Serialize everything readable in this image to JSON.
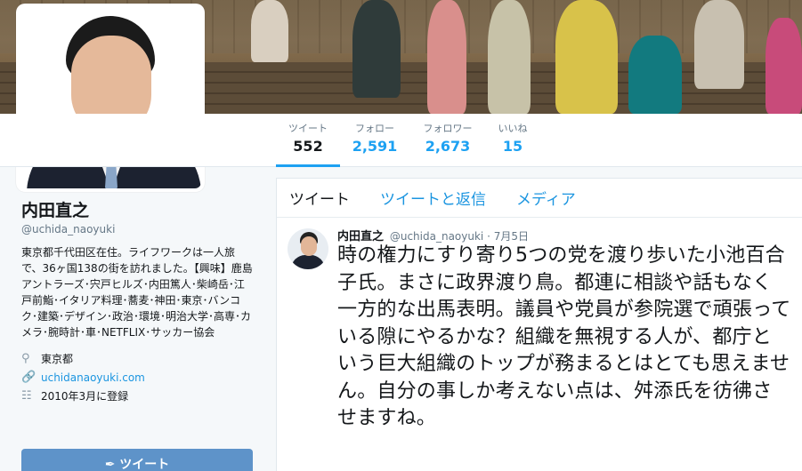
{
  "profile": {
    "name": "内田直之",
    "handle": "@uchida_naoyuki",
    "bio": "東京都千代田区在住。ライフワークは一人旅で、36ヶ国138の街を訪れました。【興味】鹿島アントラーズ･宍戸ヒルズ･内田篤人･柴崎岳･江戸前鮨･イタリア料理･蕎麦･神田･東京･バンコク･建築･デザイン･政治･環境･明治大学･高専･カメラ･腕時計･車･NETFLIX･サッカー協会",
    "location": "東京都",
    "url": "uchidanaoyuki.com",
    "joined": "2010年3月に登録",
    "tweet_button": "ツイート"
  },
  "stats": [
    {
      "label": "ツイート",
      "value": "552"
    },
    {
      "label": "フォロー",
      "value": "2,591"
    },
    {
      "label": "フォロワー",
      "value": "2,673"
    },
    {
      "label": "いいね",
      "value": "15"
    }
  ],
  "tabs": [
    "ツイート",
    "ツイートと返信",
    "メディア"
  ],
  "tweet": {
    "name": "内田直之",
    "handle": "@uchida_naoyuki",
    "date": "· 7月5日",
    "text": "時の権力にすり寄り5つの党を渡り歩いた小池百合子氏。まさに政界渡り鳥。都連に相談や話もなく一方的な出馬表明。議員や党員が参院選で頑張っている隙にやるかな？組織を無視する人が、都庁という巨大組織のトップが務まるとはとても思えません。自分の事しか考えない点は、舛添氏を彷彿させますね。"
  },
  "colors": {
    "accent": "#1da1f2",
    "link": "#1b95e0",
    "tweet_button": "#5e93c9"
  },
  "icons": {
    "location": "map-pin-icon",
    "url": "link-icon",
    "joined": "calendar-icon",
    "compose": "quill-icon"
  }
}
